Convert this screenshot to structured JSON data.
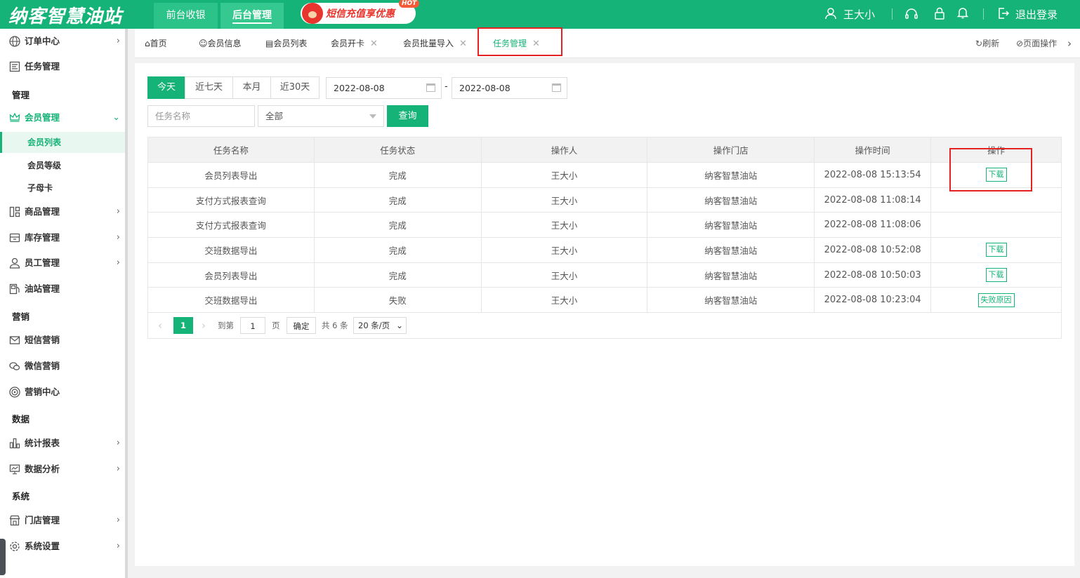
{
  "header": {
    "logo": "纳客智慧油站",
    "tabs": [
      {
        "label": "前台收银"
      },
      {
        "label": "后台管理"
      }
    ],
    "promo": {
      "text": "短信充值享优惠",
      "badge": "HOT"
    },
    "user": "王大小",
    "logout": "退出登录"
  },
  "sidebar": {
    "items": [
      {
        "label": "订单中心",
        "icon": "globe-icon"
      },
      {
        "label": "任务管理",
        "icon": "task-icon"
      },
      {
        "section": "管理"
      },
      {
        "label": "会员管理",
        "icon": "crown-icon"
      },
      {
        "sub": "会员列表"
      },
      {
        "sub": "会员等级"
      },
      {
        "sub": "子母卡"
      },
      {
        "label": "商品管理",
        "icon": "goods-icon"
      },
      {
        "label": "库存管理",
        "icon": "inventory-icon"
      },
      {
        "label": "员工管理",
        "icon": "user-icon"
      },
      {
        "label": "油站管理",
        "icon": "station-icon"
      },
      {
        "section": "营销"
      },
      {
        "label": "短信营销",
        "icon": "mail-icon"
      },
      {
        "label": "微信营销",
        "icon": "wechat-icon"
      },
      {
        "label": "营销中心",
        "icon": "target-icon"
      },
      {
        "section": "数据"
      },
      {
        "label": "统计报表",
        "icon": "bar-chart-icon"
      },
      {
        "label": "数据分析",
        "icon": "monitor-icon"
      },
      {
        "section": "系统"
      },
      {
        "label": "门店管理",
        "icon": "store-icon"
      },
      {
        "label": "系统设置",
        "icon": "gear-icon"
      }
    ]
  },
  "page_tabs": {
    "items": [
      {
        "label": "首页"
      },
      {
        "label": "会员信息"
      },
      {
        "label": "会员列表"
      },
      {
        "label": "会员开卡"
      },
      {
        "label": "会员批量导入"
      },
      {
        "label": "任务管理"
      }
    ],
    "refresh": "刷新",
    "page_ops": "页面操作"
  },
  "filters": {
    "ranges": [
      "今天",
      "近七天",
      "本月",
      "近30天"
    ],
    "date_from": "2022-08-08",
    "date_to": "2022-08-08",
    "date_sep": "-",
    "task_name_placeholder": "任务名称",
    "status_selected": "全部",
    "query": "查询"
  },
  "table": {
    "columns": [
      "任务名称",
      "任务状态",
      "操作人",
      "操作门店",
      "操作时间",
      "操作"
    ],
    "rows": [
      {
        "name": "会员列表导出",
        "status": "完成",
        "operator": "王大小",
        "store": "纳客智慧油站",
        "time": "2022-08-08 15:13:54",
        "action": "下载"
      },
      {
        "name": "支付方式报表查询",
        "status": "完成",
        "operator": "王大小",
        "store": "纳客智慧油站",
        "time": "2022-08-08 11:08:14",
        "action": ""
      },
      {
        "name": "支付方式报表查询",
        "status": "完成",
        "operator": "王大小",
        "store": "纳客智慧油站",
        "time": "2022-08-08 11:08:06",
        "action": ""
      },
      {
        "name": "交班数据导出",
        "status": "完成",
        "operator": "王大小",
        "store": "纳客智慧油站",
        "time": "2022-08-08 10:52:08",
        "action": "下载"
      },
      {
        "name": "会员列表导出",
        "status": "完成",
        "operator": "王大小",
        "store": "纳客智慧油站",
        "time": "2022-08-08 10:50:03",
        "action": "下载"
      },
      {
        "name": "交班数据导出",
        "status": "失败",
        "operator": "王大小",
        "store": "纳客智慧油站",
        "time": "2022-08-08 10:23:04",
        "action": "失败原因"
      }
    ]
  },
  "pager": {
    "current": "1",
    "goto_label": "到第",
    "goto_value": "1",
    "page_unit": "页",
    "confirm": "确定",
    "total": "共 6 条",
    "page_size": "20 条/页"
  },
  "colors": {
    "brand": "#15b377",
    "highlight": "#e52222"
  }
}
